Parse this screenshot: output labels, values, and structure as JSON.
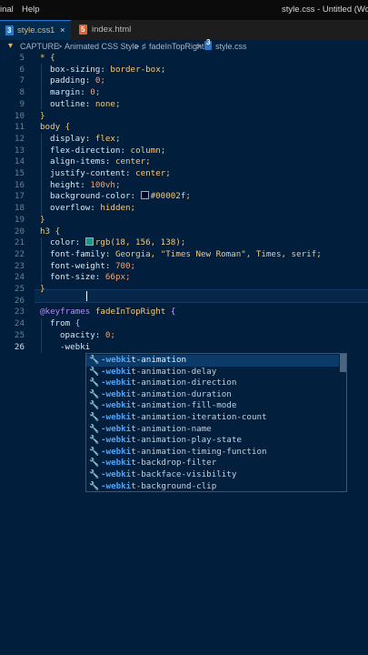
{
  "titlebar": {
    "menu_terminal": "inal",
    "menu_help": "Help",
    "window_title": "style.css - Untitled (Wo"
  },
  "tabs": [
    {
      "label": "style.css",
      "badge": "1",
      "close": "×",
      "icon": "css3-icon"
    },
    {
      "label": "index.html",
      "icon": "html5-icon"
    }
  ],
  "breadcrumb": {
    "root": "CAPTURE",
    "folder": "Animated CSS Style",
    "symbol": "fadeInTopRight",
    "file": "style.css",
    "sep": ">"
  },
  "lines": [
    {
      "n": "5"
    },
    {
      "n": "6"
    },
    {
      "n": "7"
    },
    {
      "n": "8"
    },
    {
      "n": "9"
    },
    {
      "n": "10"
    },
    {
      "n": "11"
    },
    {
      "n": "12"
    },
    {
      "n": "13"
    },
    {
      "n": "14"
    },
    {
      "n": "15"
    },
    {
      "n": "16"
    },
    {
      "n": "17"
    },
    {
      "n": "18"
    },
    {
      "n": "19"
    },
    {
      "n": "20"
    },
    {
      "n": "21"
    },
    {
      "n": "22"
    },
    {
      "n": "23"
    },
    {
      "n": "24"
    },
    {
      "n": "25"
    },
    {
      "n": "26"
    }
  ],
  "code": {
    "l5": "* {",
    "l6p": "box-sizing:",
    "l6v": "border-box;",
    "l7p": "padding:",
    "l7v": "0;",
    "l8p": "margin:",
    "l8v": "0;",
    "l9p": "outline:",
    "l9v": "none;",
    "l10": "}",
    "l11": "body {",
    "l12p": "display:",
    "l12v": "flex;",
    "l13p": "flex-direction:",
    "l13v": "column;",
    "l14p": "align-items:",
    "l14v": "center;",
    "l15p": "justify-content:",
    "l15v": "center;",
    "l16p": "height:",
    "l16v": "100vh;",
    "l17p": "background-color:",
    "l17v": "#00002f;",
    "l18p": "overflow:",
    "l18v": "hidden;",
    "l19": "}",
    "l20": "h3 {",
    "l21p": "color:",
    "l21v": "rgb(18, 156, 138);",
    "l22p": "font-family:",
    "l22v": "Georgia, \"Times New Roman\", Times, serif;",
    "l23p": "font-weight:",
    "l23v": "700;",
    "l24p": "font-size:",
    "l24v": "66px;",
    "l25": "}",
    "l27at": "@keyframes",
    "l27name": "fadeInTopRight",
    "l27b": "{",
    "l28kw": "from",
    "l28b": "{",
    "l29p": "opacity:",
    "l29v": "0;",
    "l30": "-webki"
  },
  "colors": {
    "background": "#011e3c",
    "swatch1": "#00002f",
    "swatch2": "#129c8a",
    "accent": "#1f7ad8"
  },
  "suggestions": [
    {
      "prefix": "-webki",
      "rest": "t-animation"
    },
    {
      "prefix": "-webki",
      "rest": "t-animation-delay"
    },
    {
      "prefix": "-webki",
      "rest": "t-animation-direction"
    },
    {
      "prefix": "-webki",
      "rest": "t-animation-duration"
    },
    {
      "prefix": "-webki",
      "rest": "t-animation-fill-mode"
    },
    {
      "prefix": "-webki",
      "rest": "t-animation-iteration-count"
    },
    {
      "prefix": "-webki",
      "rest": "t-animation-name"
    },
    {
      "prefix": "-webki",
      "rest": "t-animation-play-state"
    },
    {
      "prefix": "-webki",
      "rest": "t-animation-timing-function"
    },
    {
      "prefix": "-webki",
      "rest": "t-backdrop-filter"
    },
    {
      "prefix": "-webki",
      "rest": "t-backface-visibility"
    },
    {
      "prefix": "-webki",
      "rest": "t-background-clip"
    }
  ]
}
